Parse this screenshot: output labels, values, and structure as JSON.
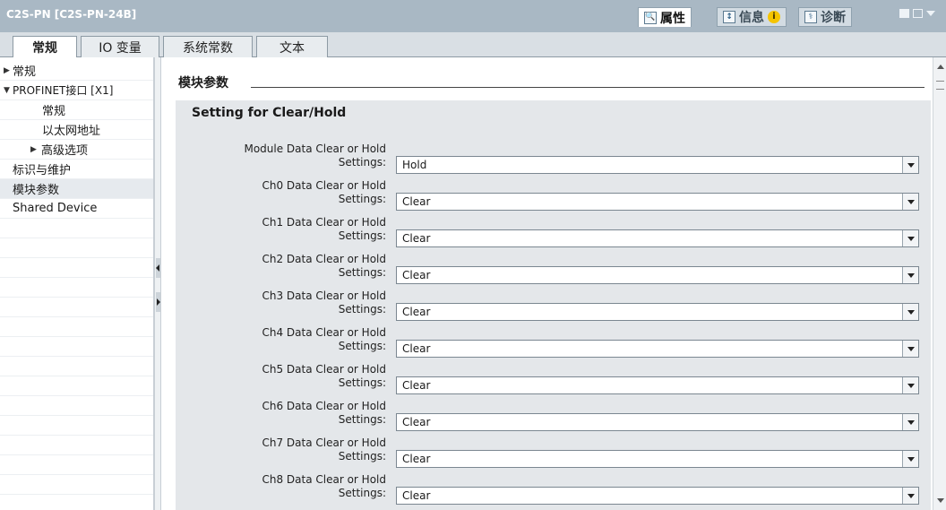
{
  "window": {
    "title": "C2S-PN [C2S-PN-24B]"
  },
  "inspector_tabs": [
    {
      "label": "属性",
      "icon": "properties-icon",
      "active": true
    },
    {
      "label": "信息",
      "icon": "info-list-icon",
      "badge": "i",
      "active": false
    },
    {
      "label": "诊断",
      "icon": "diagnostics-icon",
      "active": false
    }
  ],
  "main_tabs": [
    {
      "label": "常规",
      "active": true
    },
    {
      "label": "IO 变量",
      "active": false
    },
    {
      "label": "系统常数",
      "active": false
    },
    {
      "label": "文本",
      "active": false
    }
  ],
  "sidebar": {
    "items": [
      {
        "label": "常规",
        "twisty": "▶"
      },
      {
        "label": "PROFINET接口 [X1]",
        "twisty": "▼"
      },
      {
        "label": "常规",
        "twisty": ""
      },
      {
        "label": "以太网地址",
        "twisty": ""
      },
      {
        "label": "高级选项",
        "twisty": "▶"
      },
      {
        "label": "标识与维护",
        "twisty": ""
      },
      {
        "label": "模块参数",
        "twisty": "",
        "selected": true
      },
      {
        "label": "Shared Device",
        "twisty": ""
      }
    ]
  },
  "content": {
    "section_title": "模块参数",
    "panel_title": "Setting for Clear/Hold",
    "params": [
      {
        "label_line1": "Module Data Clear or Hold",
        "label_line2": "Settings:",
        "value": "Hold"
      },
      {
        "label_line1": "Ch0 Data Clear or Hold",
        "label_line2": "Settings:",
        "value": "Clear"
      },
      {
        "label_line1": "Ch1 Data Clear or Hold",
        "label_line2": "Settings:",
        "value": "Clear"
      },
      {
        "label_line1": "Ch2 Data Clear or Hold",
        "label_line2": "Settings:",
        "value": "Clear"
      },
      {
        "label_line1": "Ch3 Data Clear or Hold",
        "label_line2": "Settings:",
        "value": "Clear"
      },
      {
        "label_line1": "Ch4 Data Clear or Hold",
        "label_line2": "Settings:",
        "value": "Clear"
      },
      {
        "label_line1": "Ch5 Data Clear or Hold",
        "label_line2": "Settings:",
        "value": "Clear"
      },
      {
        "label_line1": "Ch6 Data Clear or Hold",
        "label_line2": "Settings:",
        "value": "Clear"
      },
      {
        "label_line1": "Ch7 Data Clear or Hold",
        "label_line2": "Settings:",
        "value": "Clear"
      },
      {
        "label_line1": "Ch8 Data Clear or Hold",
        "label_line2": "Settings:",
        "value": "Clear"
      }
    ]
  },
  "colors": {
    "titlebar": "#a9b8c4",
    "panel_bg": "#e4e7ea",
    "selected_row": "#e6eaee"
  }
}
